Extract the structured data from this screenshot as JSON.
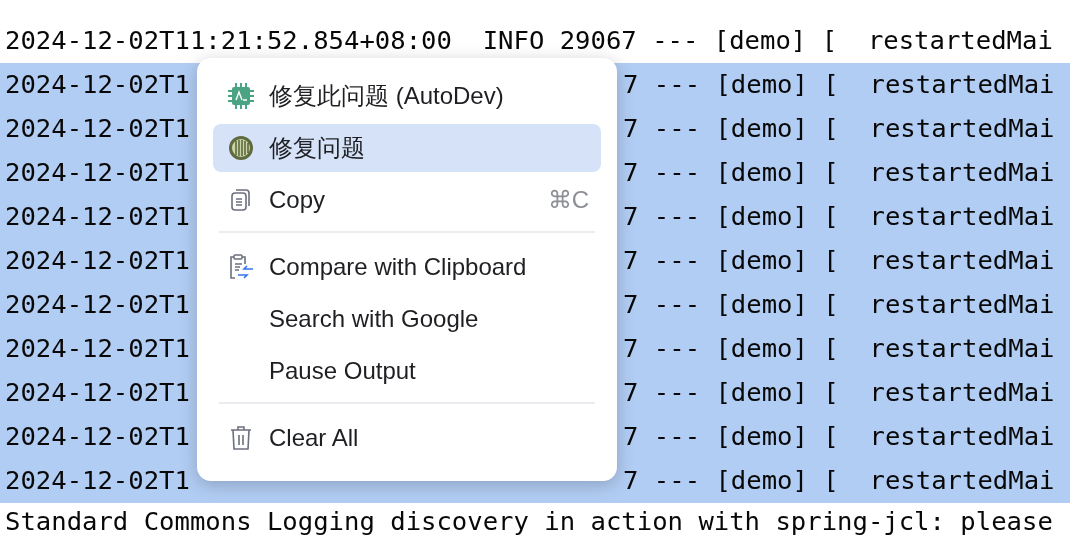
{
  "console": {
    "lines": [
      {
        "kind": "full",
        "selected": false,
        "text": "2024-12-02T11:21:52.854+08:00  INFO 29067 --- [demo] [  restartedMai"
      },
      {
        "kind": "split",
        "selected": true,
        "start": "2024-12-02T1",
        "end": "7 --- [demo] [  restartedMai"
      },
      {
        "kind": "split",
        "selected": true,
        "start": "2024-12-02T1",
        "end": "7 --- [demo] [  restartedMai"
      },
      {
        "kind": "split",
        "selected": true,
        "start": "2024-12-02T1",
        "end": "7 --- [demo] [  restartedMai"
      },
      {
        "kind": "split",
        "selected": true,
        "start": "2024-12-02T1",
        "end": "7 --- [demo] [  restartedMai"
      },
      {
        "kind": "split",
        "selected": true,
        "start": "2024-12-02T1",
        "end": "7 --- [demo] [  restartedMai"
      },
      {
        "kind": "split",
        "selected": true,
        "start": "2024-12-02T1",
        "end": "7 --- [demo] [  restartedMai"
      },
      {
        "kind": "split",
        "selected": true,
        "start": "2024-12-02T1",
        "end": "7 --- [demo] [  restartedMai"
      },
      {
        "kind": "split",
        "selected": true,
        "start": "2024-12-02T1",
        "end": "7 --- [demo] [  restartedMai"
      },
      {
        "kind": "split",
        "selected": true,
        "start": "2024-12-02T1",
        "end": "7 --- [demo] [  restartedMai"
      },
      {
        "kind": "split",
        "selected": true,
        "start": "2024-12-02T1",
        "end": "7 --- [demo] [  restartedMai"
      },
      {
        "kind": "full",
        "selected": false,
        "text": "Standard Commons Logging discovery in action with spring-jcl: please"
      }
    ]
  },
  "context_menu": {
    "items": [
      {
        "kind": "item",
        "label": "修复此问题 (AutoDev)",
        "selected": false
      },
      {
        "kind": "item",
        "label": "修复问题",
        "selected": true
      },
      {
        "kind": "item",
        "label": "Copy",
        "shortcut": "⌘C",
        "selected": false
      },
      {
        "kind": "separator"
      },
      {
        "kind": "item",
        "label": "Compare with Clipboard",
        "selected": false
      },
      {
        "kind": "item",
        "label": "Search with Google",
        "selected": false
      },
      {
        "kind": "item",
        "label": "Pause Output",
        "selected": false
      },
      {
        "kind": "separator"
      },
      {
        "kind": "item",
        "label": "Clear All",
        "selected": false
      }
    ]
  }
}
